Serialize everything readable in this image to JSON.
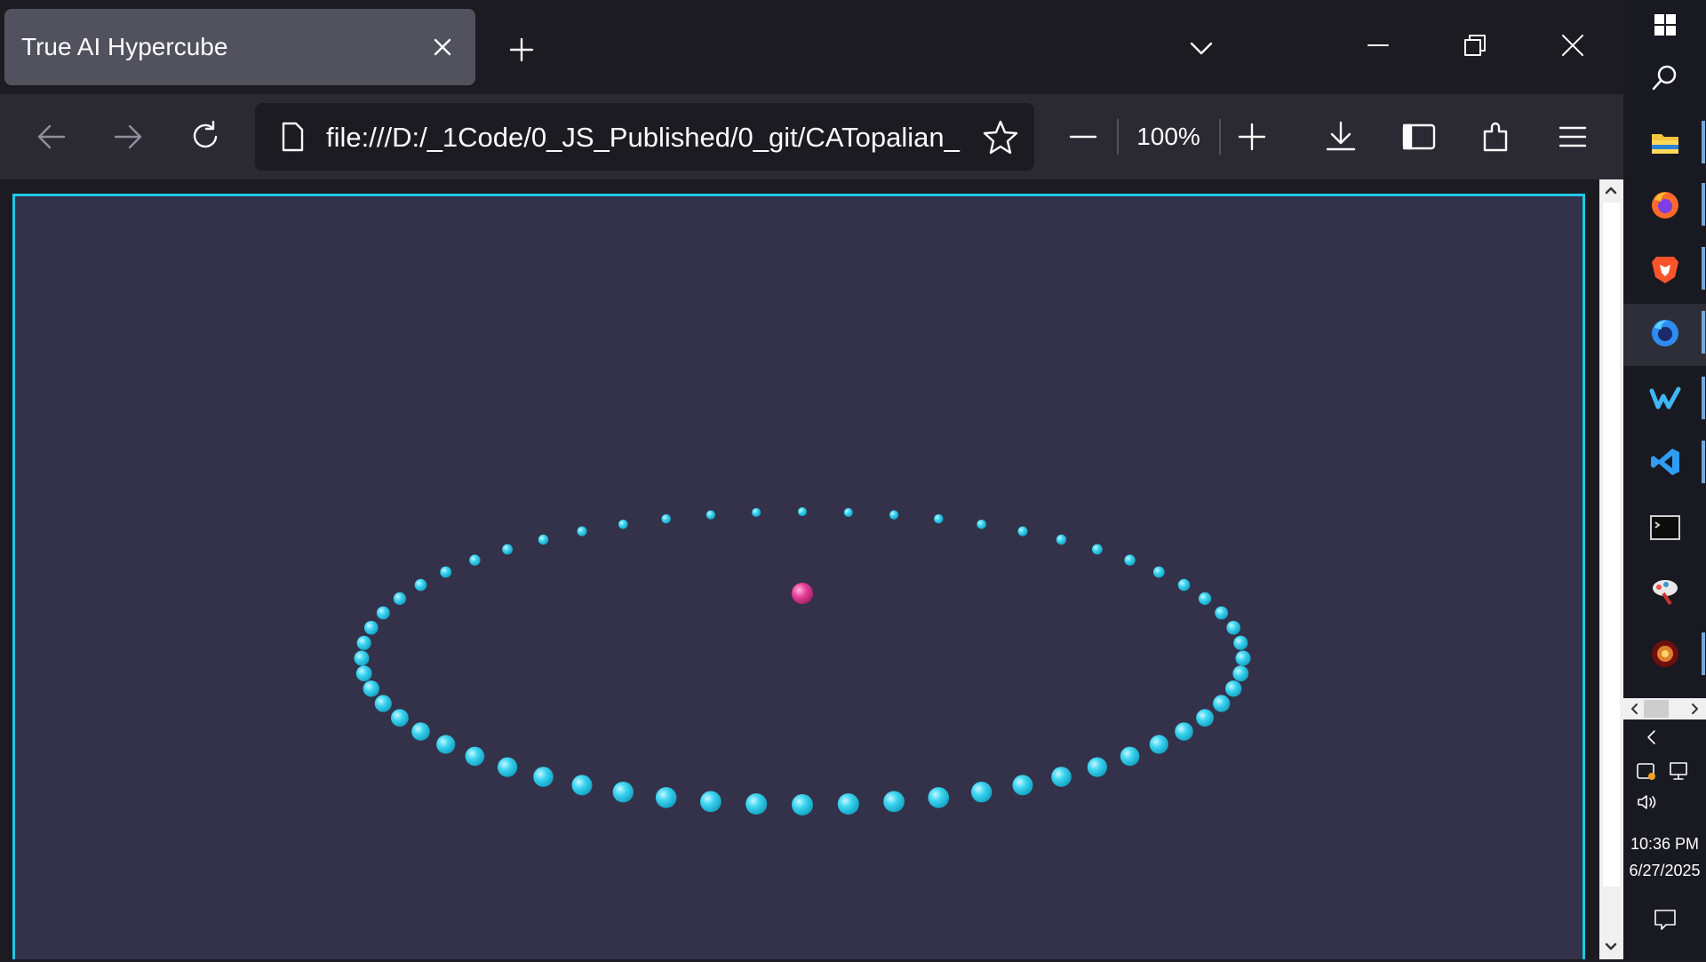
{
  "browser": {
    "tab": {
      "title": "True AI Hypercube",
      "close_icon": "close-icon"
    },
    "new_tab_icon": "plus-icon",
    "tab_list_icon": "chevron-down-icon",
    "window_controls": [
      "minimize-icon",
      "restore-icon",
      "close-icon"
    ],
    "nav": {
      "back_icon": "arrow-left-icon",
      "forward_icon": "arrow-right-icon",
      "reload_icon": "reload-icon",
      "url": "file:///D:/_1Code/0_JS_Published/0_git/CATopalian_",
      "page_icon": "file-icon",
      "bookmark_icon": "star-icon",
      "zoom_out_icon": "minus-icon",
      "zoom_level": "100%",
      "zoom_in_icon": "plus-icon",
      "downloads_icon": "download-icon",
      "sidebar_icon": "sidebar-icon",
      "extensions_icon": "puzzle-icon",
      "menu_icon": "hamburger-icon"
    }
  },
  "canvas": {
    "frame_color": "#1ec9e6",
    "background": "#33324a",
    "ring_node_count": 60,
    "ring_node_color": "#3fd6f2",
    "center_node_color": "#e8409a"
  },
  "taskbar": {
    "apps": [
      "windows-start-icon",
      "search-icon",
      "file-explorer-icon",
      "firefox-icon",
      "brave-icon",
      "firefox-dev-icon",
      "windsurf-icon",
      "vscode-icon",
      "terminal-icon",
      "paint-icon",
      "game-icon"
    ],
    "tray_icons": [
      "chevron-left-icon",
      "sync-icon",
      "network-icon",
      "volume-icon"
    ],
    "clock": {
      "time": "10:36 PM",
      "date": "6/27/2025"
    },
    "notification_icon": "notification-icon"
  }
}
